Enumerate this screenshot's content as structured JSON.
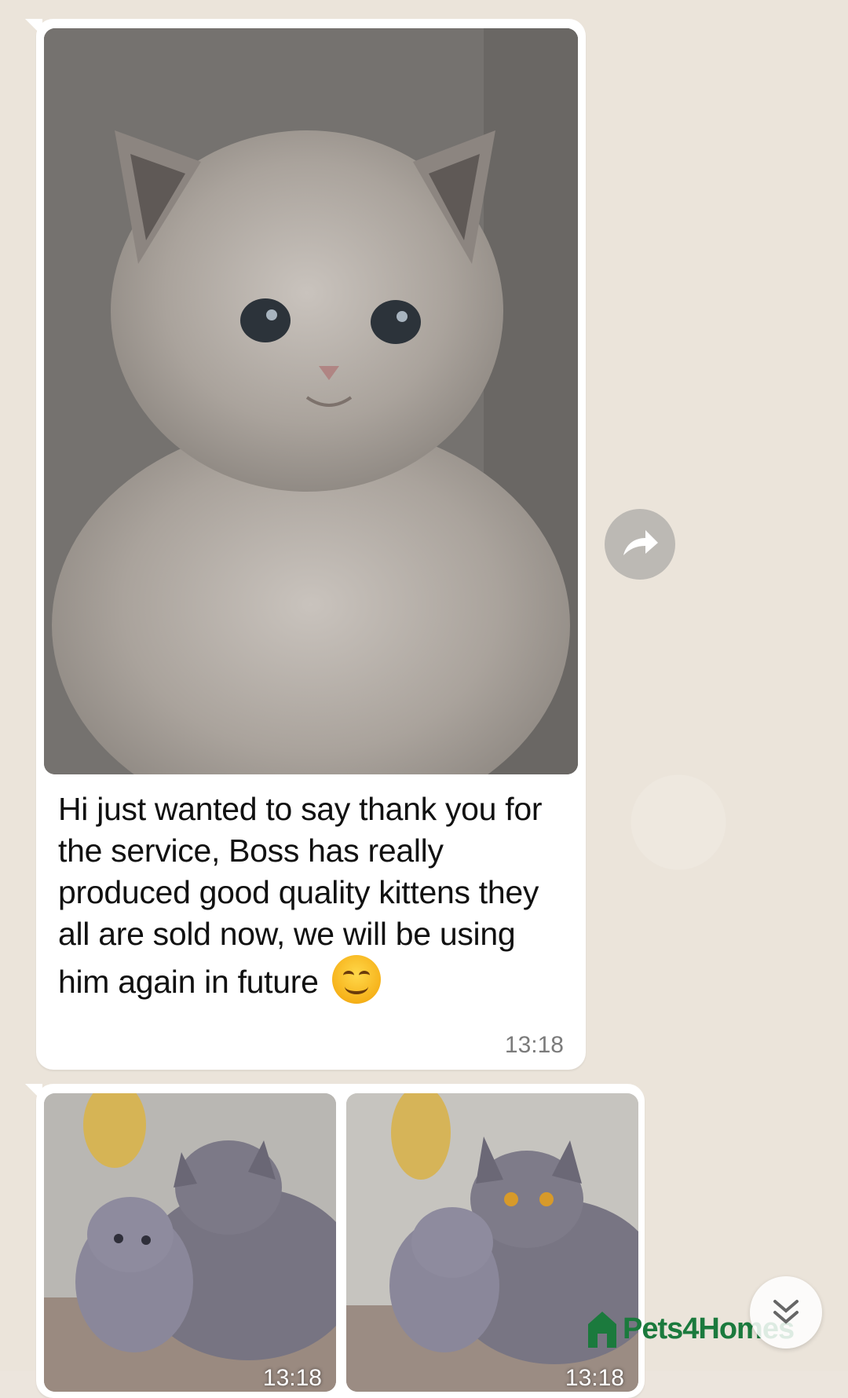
{
  "messages": [
    {
      "type": "image_with_caption",
      "image_icon": "kitten-photo",
      "text": "Hi just wanted to say thank you for the service, Boss has really produced good quality kittens they all are sold now, we will be using him again in future",
      "emoji": "smiling-face-emoji",
      "time": "13:18"
    },
    {
      "type": "image_pair",
      "images": [
        {
          "icon": "cat-and-kitten-photo",
          "time": "13:18"
        },
        {
          "icon": "cat-and-kitten-photo",
          "time": "13:18"
        }
      ]
    }
  ],
  "controls": {
    "forward_icon": "forward-arrow-icon",
    "scroll_down_icon": "double-chevron-down-icon"
  },
  "watermark": {
    "text": "Pets4Homes",
    "color": "#1b7a3d"
  },
  "colors": {
    "bubble": "#ffffff",
    "wallpaper": "#ebe4da",
    "time_text": "#7b7b7b"
  }
}
